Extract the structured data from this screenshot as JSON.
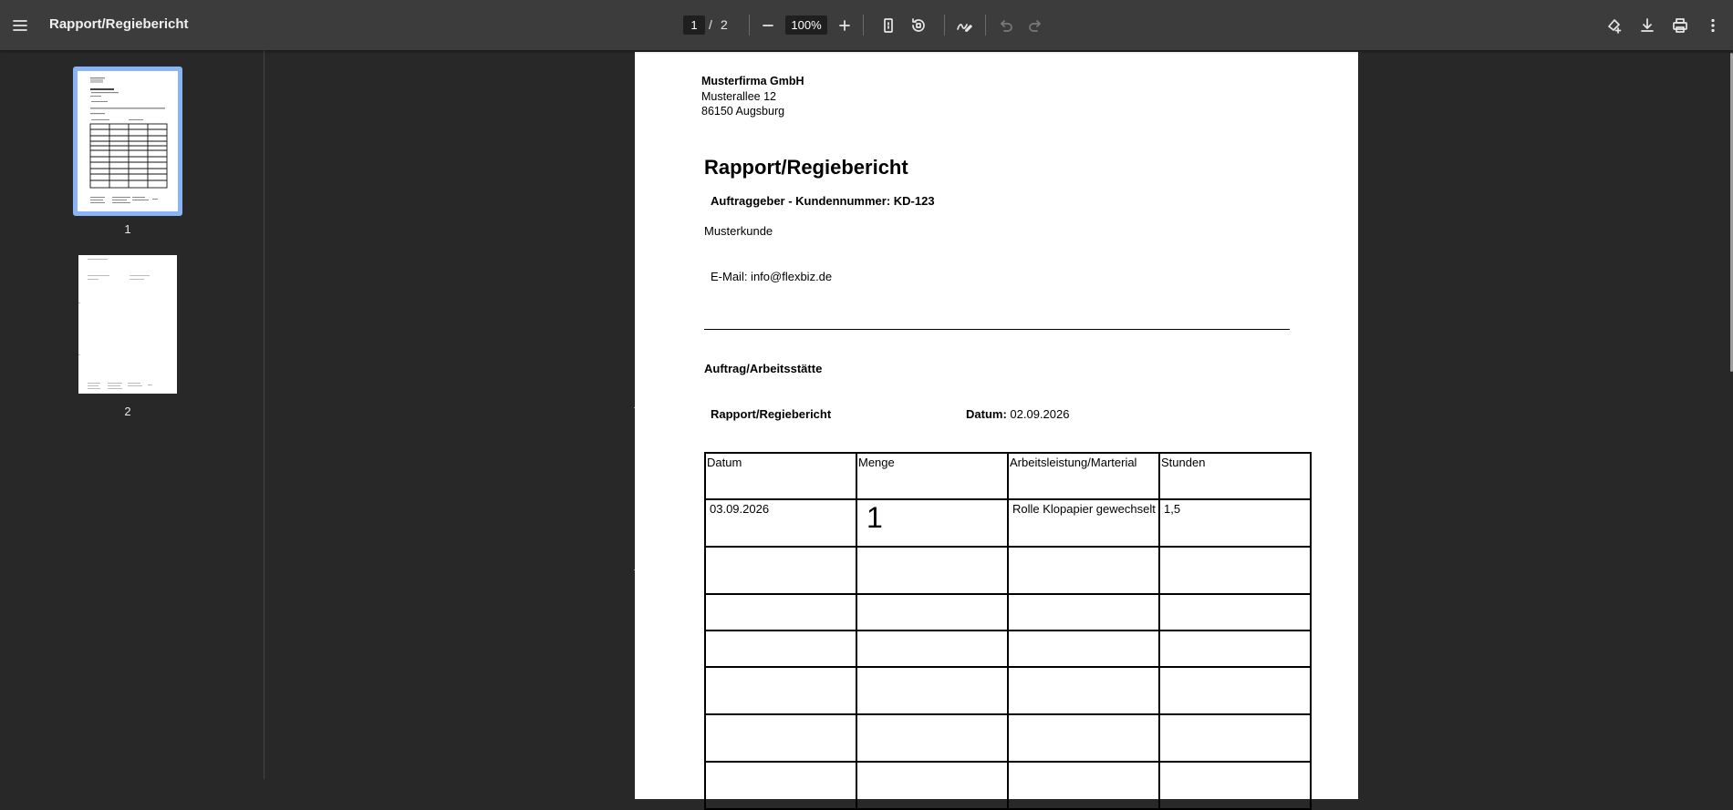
{
  "toolbar": {
    "title": "Rapport/Regiebericht",
    "current_page": "1",
    "page_separator": "/",
    "total_pages": "2",
    "zoom": "100%",
    "icons": [
      "menu-icon",
      "zoom-out-icon",
      "zoom-in-icon",
      "fit-page-icon",
      "rotate-icon",
      "annotate-icon",
      "undo-icon",
      "redo-icon",
      "edit-pdf-icon",
      "download-icon",
      "print-icon",
      "more-options-icon"
    ]
  },
  "sidebar": {
    "thumbnails": [
      {
        "label": "1",
        "selected": true
      },
      {
        "label": "2",
        "selected": false
      }
    ]
  },
  "document": {
    "company": {
      "name": "Musterfirma GmbH",
      "street": "Musterallee 12",
      "city": "86150 Augsburg"
    },
    "title": "Rapport/Regiebericht",
    "client_header": "Auftraggeber - Kundennummer: KD-123",
    "client_name": "Musterkunde",
    "email": "E-Mail: info@flexbiz.de",
    "section_title": "Auftrag/Arbeitsstätte",
    "report_label": "Rapport/Regiebericht",
    "date_label": "Datum:",
    "date_value": "02.09.2026",
    "table": {
      "headers": [
        "Datum",
        "Menge",
        "Arbeitsleistung/Marterial",
        "Stunden"
      ],
      "rows": [
        [
          "03.09.2026",
          "1",
          "Rolle Klopapier gewechselt",
          "1,5"
        ],
        [
          "",
          "",
          "",
          ""
        ],
        [
          "",
          "",
          "",
          ""
        ],
        [
          "",
          "",
          "",
          ""
        ],
        [
          "",
          "",
          "",
          ""
        ],
        [
          "",
          "",
          "",
          ""
        ],
        [
          "",
          "",
          "",
          ""
        ]
      ]
    }
  },
  "colors": {
    "toolbar_bg": "#3c3c3c",
    "viewer_bg": "#282828",
    "thumbnail_highlight": "#8ab4f8"
  }
}
